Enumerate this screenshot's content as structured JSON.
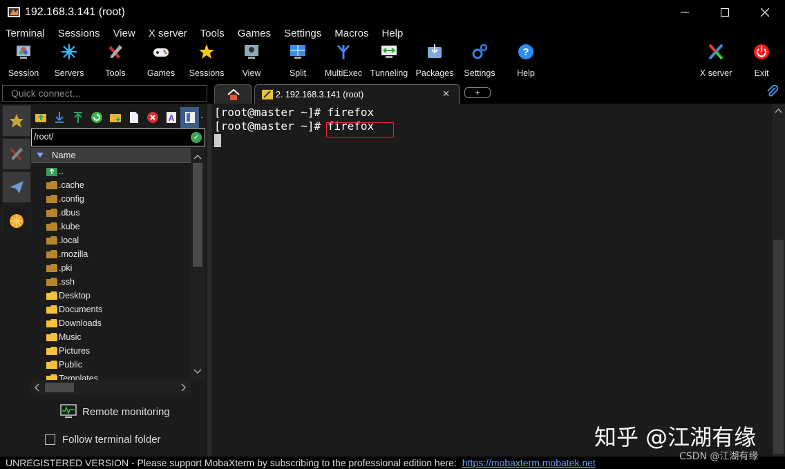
{
  "window": {
    "title": "192.168.3.141 (root)"
  },
  "menu": [
    "Terminal",
    "Sessions",
    "View",
    "X server",
    "Tools",
    "Games",
    "Settings",
    "Macros",
    "Help"
  ],
  "toolbar": [
    {
      "label": "Session",
      "icon": "session-icon"
    },
    {
      "label": "Servers",
      "icon": "servers-icon"
    },
    {
      "label": "Tools",
      "icon": "tools-icon"
    },
    {
      "label": "Games",
      "icon": "games-icon"
    },
    {
      "label": "Sessions",
      "icon": "star-icon"
    },
    {
      "label": "View",
      "icon": "view-icon"
    },
    {
      "label": "Split",
      "icon": "split-icon"
    },
    {
      "label": "MultiExec",
      "icon": "multiexec-icon"
    },
    {
      "label": "Tunneling",
      "icon": "tunneling-icon"
    },
    {
      "label": "Packages",
      "icon": "packages-icon"
    },
    {
      "label": "Settings",
      "icon": "settings-icon"
    },
    {
      "label": "Help",
      "icon": "help-icon"
    },
    {
      "label": "X server",
      "icon": "x-server-icon"
    },
    {
      "label": "Exit",
      "icon": "exit-icon"
    }
  ],
  "quick_connect": {
    "placeholder": "Quick connect..."
  },
  "tabs": {
    "session_label": "2. 192.168.3.141 (root)",
    "close": "✕",
    "new_tab": "+"
  },
  "browser": {
    "path": "/root/",
    "column_name": "Name",
    "files": [
      {
        "name": "..",
        "kind": "up"
      },
      {
        "name": ".cache",
        "kind": "hidden"
      },
      {
        "name": ".config",
        "kind": "hidden"
      },
      {
        "name": ".dbus",
        "kind": "hidden"
      },
      {
        "name": ".kube",
        "kind": "hidden"
      },
      {
        "name": ".local",
        "kind": "hidden"
      },
      {
        "name": ".mozilla",
        "kind": "hidden"
      },
      {
        "name": ".pki",
        "kind": "hidden"
      },
      {
        "name": ".ssh",
        "kind": "hidden"
      },
      {
        "name": "Desktop",
        "kind": "folder"
      },
      {
        "name": "Documents",
        "kind": "folder"
      },
      {
        "name": "Downloads",
        "kind": "folder"
      },
      {
        "name": "Music",
        "kind": "folder"
      },
      {
        "name": "Pictures",
        "kind": "folder"
      },
      {
        "name": "Public",
        "kind": "folder"
      },
      {
        "name": "Templates",
        "kind": "folder"
      }
    ],
    "remote_monitoring": "Remote monitoring",
    "follow_terminal": "Follow terminal folder"
  },
  "terminal": {
    "lines": [
      "[root@master ~]# firefox",
      "[root@master ~]# firefox"
    ],
    "highlight_color": "#e03030"
  },
  "status": {
    "text": "UNREGISTERED VERSION  -  Please support MobaXterm by subscribing to the professional edition here:",
    "link": "https://mobaxterm.mobatek.net"
  },
  "watermark": {
    "main": "知乎 @江湖有缘",
    "small": "CSDN @江湖有缘"
  }
}
